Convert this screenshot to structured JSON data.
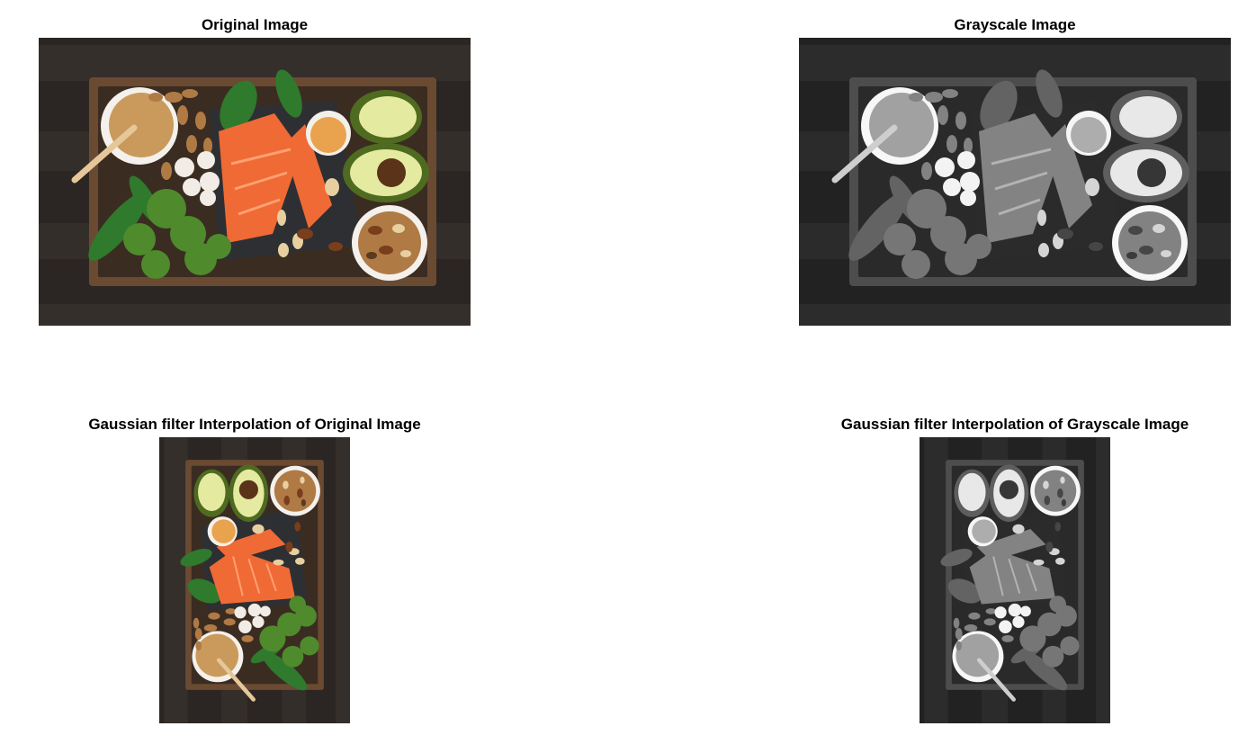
{
  "figure": {
    "panels": [
      {
        "id": "original",
        "title": "Original Image",
        "style": "color",
        "orientation": "landscape"
      },
      {
        "id": "grayscale",
        "title": "Grayscale Image",
        "style": "grayscale",
        "orientation": "landscape"
      },
      {
        "id": "gauss-original",
        "title": "Gaussian filter Interpolation of Original Image",
        "style": "color",
        "orientation": "portrait"
      },
      {
        "id": "gauss-gray",
        "title": "Gaussian filter Interpolation of Grayscale Image",
        "style": "grayscale",
        "orientation": "portrait"
      }
    ]
  },
  "colors": {
    "wood_dark": "#2b2623",
    "wood_plank": "#3a332f",
    "tray_frame": "#6b4a32",
    "slate": "#2e2f33",
    "salmon": "#f06a35",
    "salmon_light": "#ffa070",
    "avocado_skin": "#4e6b1f",
    "avocado_flesh": "#e4eaa0",
    "avocado_pit": "#5a3318",
    "broccoli": "#4f8a2c",
    "spinach": "#2f7a2c",
    "nut": "#b07a45",
    "pecan": "#7a3e1c",
    "peanut_butter": "#c99a5b",
    "bowl": "#f4f1ec",
    "egg": "#e9a24e",
    "mushroom": "#f1ede6"
  }
}
